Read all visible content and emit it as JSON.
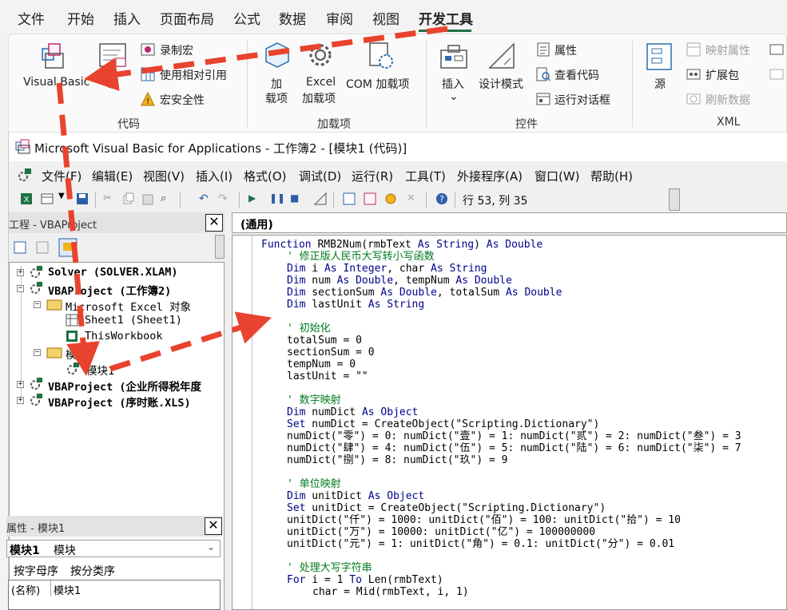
{
  "ribbon": {
    "tabs": [
      "文件",
      "开始",
      "插入",
      "页面布局",
      "公式",
      "数据",
      "审阅",
      "视图",
      "开发工具"
    ],
    "active_tab": "开发工具",
    "groups": {
      "code": {
        "label": "代码",
        "visual_basic": "Visual Basic",
        "macros": "宏",
        "record_macro": "录制宏",
        "relative_ref": "使用相对引用",
        "macro_security": "宏安全性"
      },
      "addins": {
        "label": "加载项",
        "addins": [
          "加",
          "载项"
        ],
        "excel_addins": [
          "Excel",
          "加载项"
        ],
        "com_addins": "COM 加载项"
      },
      "controls": {
        "label": "控件",
        "insert": "插入",
        "design_mode": "设计模式",
        "properties": "属性",
        "view_code": "查看代码",
        "run_dialog": "运行对话框"
      },
      "xml": {
        "label": "XML",
        "source": "源",
        "map_properties": "映射属性",
        "expansion_packs": "扩展包",
        "refresh_data": "刷新数据"
      }
    }
  },
  "vbe": {
    "title": "Microsoft Visual Basic for Applications - 工作簿2 - [模块1 (代码)]",
    "menu": [
      "文件(F)",
      "编辑(E)",
      "视图(V)",
      "插入(I)",
      "格式(O)",
      "调试(D)",
      "运行(R)",
      "工具(T)",
      "外接程序(A)",
      "窗口(W)",
      "帮助(H)"
    ],
    "cursor_position": "行 53, 列 35",
    "project_panel": {
      "title": "工程 - VBAProject",
      "tree": [
        {
          "label": "Solver (SOLVER.XLAM)",
          "bold": true,
          "sign": "+"
        },
        {
          "label": "VBAProject (工作簿2)",
          "bold": true,
          "sign": "−"
        },
        {
          "label": "Microsoft Excel 对象",
          "bold": false,
          "sign": "−"
        },
        {
          "label": "Sheet1 (Sheet1)",
          "bold": false,
          "sign": ""
        },
        {
          "label": "ThisWorkbook",
          "bold": false,
          "sign": ""
        },
        {
          "label": "模块",
          "bold": false,
          "sign": "−"
        },
        {
          "label": "模块1",
          "bold": false,
          "sign": ""
        },
        {
          "label": "VBAProject (企业所得税年度",
          "bold": true,
          "sign": "+"
        },
        {
          "label": "VBAProject (序时账.XLS)",
          "bold": true,
          "sign": "+"
        }
      ]
    },
    "properties_panel": {
      "title": "属性 - 模块1",
      "object": "模块1",
      "object_type": "模块",
      "tabs": [
        "按字母序",
        "按分类序"
      ],
      "rows": [
        {
          "name": "(名称)",
          "value": "模块1"
        }
      ]
    },
    "code_window": {
      "object_combo": "(通用)",
      "lines": [
        {
          "text": "Function RMB2Num(rmbText As String) As Double",
          "type": "kw",
          "indent": 0
        },
        {
          "text": "' 修正版人民币大写转小写函数",
          "type": "cm",
          "indent": 1
        },
        {
          "text": "Dim i As Integer, char As String",
          "type": "kw",
          "indent": 1
        },
        {
          "text": "Dim num As Double, tempNum As Double",
          "type": "kw",
          "indent": 1
        },
        {
          "text": "Dim sectionSum As Double, totalSum As Double",
          "type": "kw",
          "indent": 1
        },
        {
          "text": "Dim lastUnit As String",
          "type": "kw",
          "indent": 1
        },
        {
          "text": "",
          "type": "plain",
          "indent": 0
        },
        {
          "text": "' 初始化",
          "type": "cm",
          "indent": 1
        },
        {
          "text": "totalSum = 0",
          "type": "plain",
          "indent": 1
        },
        {
          "text": "sectionSum = 0",
          "type": "plain",
          "indent": 1
        },
        {
          "text": "tempNum = 0",
          "type": "plain",
          "indent": 1
        },
        {
          "text": "lastUnit = \"\"",
          "type": "plain",
          "indent": 1
        },
        {
          "text": "",
          "type": "plain",
          "indent": 0
        },
        {
          "text": "' 数字映射",
          "type": "cm",
          "indent": 1
        },
        {
          "text": "Dim numDict As Object",
          "type": "kw",
          "indent": 1
        },
        {
          "text": "Set numDict = CreateObject(\"Scripting.Dictionary\")",
          "type": "kw",
          "indent": 1
        },
        {
          "text": "numDict(\"零\") = 0: numDict(\"壹\") = 1: numDict(\"贰\") = 2: numDict(\"叁\") = 3",
          "type": "plain",
          "indent": 1
        },
        {
          "text": "numDict(\"肆\") = 4: numDict(\"伍\") = 5: numDict(\"陆\") = 6: numDict(\"柒\") = 7",
          "type": "plain",
          "indent": 1
        },
        {
          "text": "numDict(\"捌\") = 8: numDict(\"玖\") = 9",
          "type": "plain",
          "indent": 1
        },
        {
          "text": "",
          "type": "plain",
          "indent": 0
        },
        {
          "text": "' 单位映射",
          "type": "cm",
          "indent": 1
        },
        {
          "text": "Dim unitDict As Object",
          "type": "kw",
          "indent": 1
        },
        {
          "text": "Set unitDict = CreateObject(\"Scripting.Dictionary\")",
          "type": "kw",
          "indent": 1
        },
        {
          "text": "unitDict(\"仟\") = 1000: unitDict(\"佰\") = 100: unitDict(\"拾\") = 10",
          "type": "plain",
          "indent": 1
        },
        {
          "text": "unitDict(\"万\") = 10000: unitDict(\"亿\") = 100000000",
          "type": "plain",
          "indent": 1
        },
        {
          "text": "unitDict(\"元\") = 1: unitDict(\"角\") = 0.1: unitDict(\"分\") = 0.01",
          "type": "plain",
          "indent": 1
        },
        {
          "text": "",
          "type": "plain",
          "indent": 0
        },
        {
          "text": "' 处理大写字符串",
          "type": "cm",
          "indent": 1
        },
        {
          "text": "For i = 1 To Len(rmbText)",
          "type": "kw",
          "indent": 1
        },
        {
          "text": "char = Mid(rmbText, i, 1)",
          "type": "plain",
          "indent": 2
        }
      ]
    }
  },
  "colors": {
    "arrow": "#e8432e",
    "accent_green": "#1e7145",
    "keyword": "#00008b",
    "comment": "#007a1f"
  }
}
